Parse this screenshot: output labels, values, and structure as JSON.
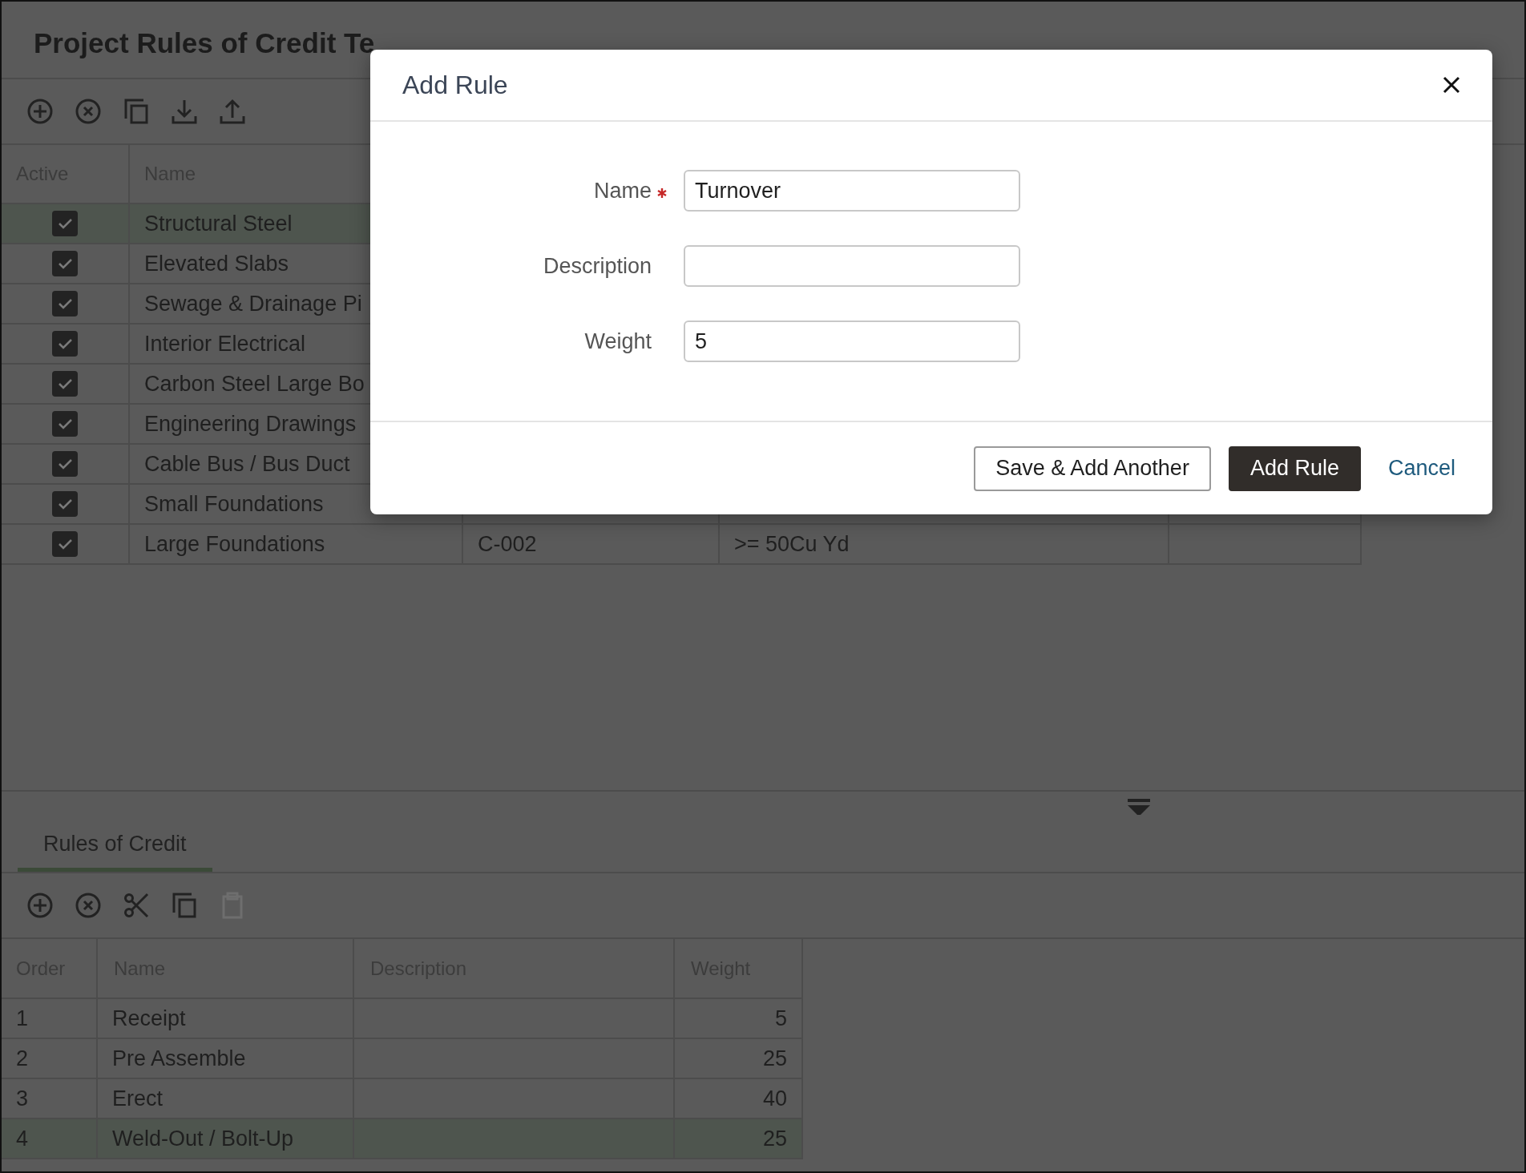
{
  "page": {
    "title": "Project Rules of Credit Te"
  },
  "toolbar": [
    {
      "kind": "add",
      "disabled": false
    },
    {
      "kind": "remove",
      "disabled": false
    },
    {
      "kind": "copy",
      "disabled": false
    },
    {
      "kind": "download",
      "disabled": false
    },
    {
      "kind": "upload",
      "disabled": false
    }
  ],
  "templates_table": {
    "columns": [
      "Active",
      "Name"
    ],
    "rows": [
      {
        "active": true,
        "name": "Structural Steel",
        "selected": true
      },
      {
        "active": true,
        "name": "Elevated Slabs",
        "selected": false
      },
      {
        "active": true,
        "name": "Sewage & Drainage Pi",
        "selected": false
      },
      {
        "active": true,
        "name": "Interior Electrical",
        "selected": false
      },
      {
        "active": true,
        "name": "Carbon Steel Large Bo",
        "selected": false
      },
      {
        "active": true,
        "name": "Engineering Drawings",
        "selected": false
      },
      {
        "active": true,
        "name": "Cable Bus / Bus Duct",
        "selected": false
      },
      {
        "active": true,
        "name": "Small Foundations",
        "selected": false
      },
      {
        "active": true,
        "name": "Large Foundations",
        "selected": false,
        "column_3": "C-002",
        "column_4": ">= 50Cu Yd"
      }
    ]
  },
  "tabs": [
    {
      "label": "Rules of Credit",
      "selected": true
    }
  ],
  "rules_toolbar": [
    {
      "kind": "add",
      "disabled": false
    },
    {
      "kind": "remove",
      "disabled": false
    },
    {
      "kind": "cut",
      "disabled": false
    },
    {
      "kind": "copy",
      "disabled": false
    },
    {
      "kind": "paste",
      "disabled": true
    }
  ],
  "rules_table": {
    "columns": [
      "Order",
      "Name",
      "Description",
      "Weight"
    ],
    "rows": [
      {
        "order": "1",
        "name": "Receipt",
        "weight": "5",
        "selected": false
      },
      {
        "order": "2",
        "name": "Pre Assemble",
        "weight": "25",
        "selected": false
      },
      {
        "order": "3",
        "name": "Erect",
        "weight": "40",
        "selected": false
      },
      {
        "order": "4",
        "name": "Weld-Out / Bolt-Up",
        "weight": "25",
        "selected": true
      }
    ]
  },
  "dialog": {
    "title": "Add Rule",
    "fields": [
      {
        "label": "Name",
        "required": true,
        "value": "Turnover"
      },
      {
        "label": "Description",
        "required": false
      },
      {
        "label": "Weight",
        "required": false,
        "value": "5"
      }
    ],
    "buttons": [
      {
        "label": "Save & Add Another",
        "kind": "secondary"
      },
      {
        "label": "Add Rule",
        "kind": "primary"
      },
      {
        "label": "Cancel",
        "kind": "link"
      }
    ]
  }
}
